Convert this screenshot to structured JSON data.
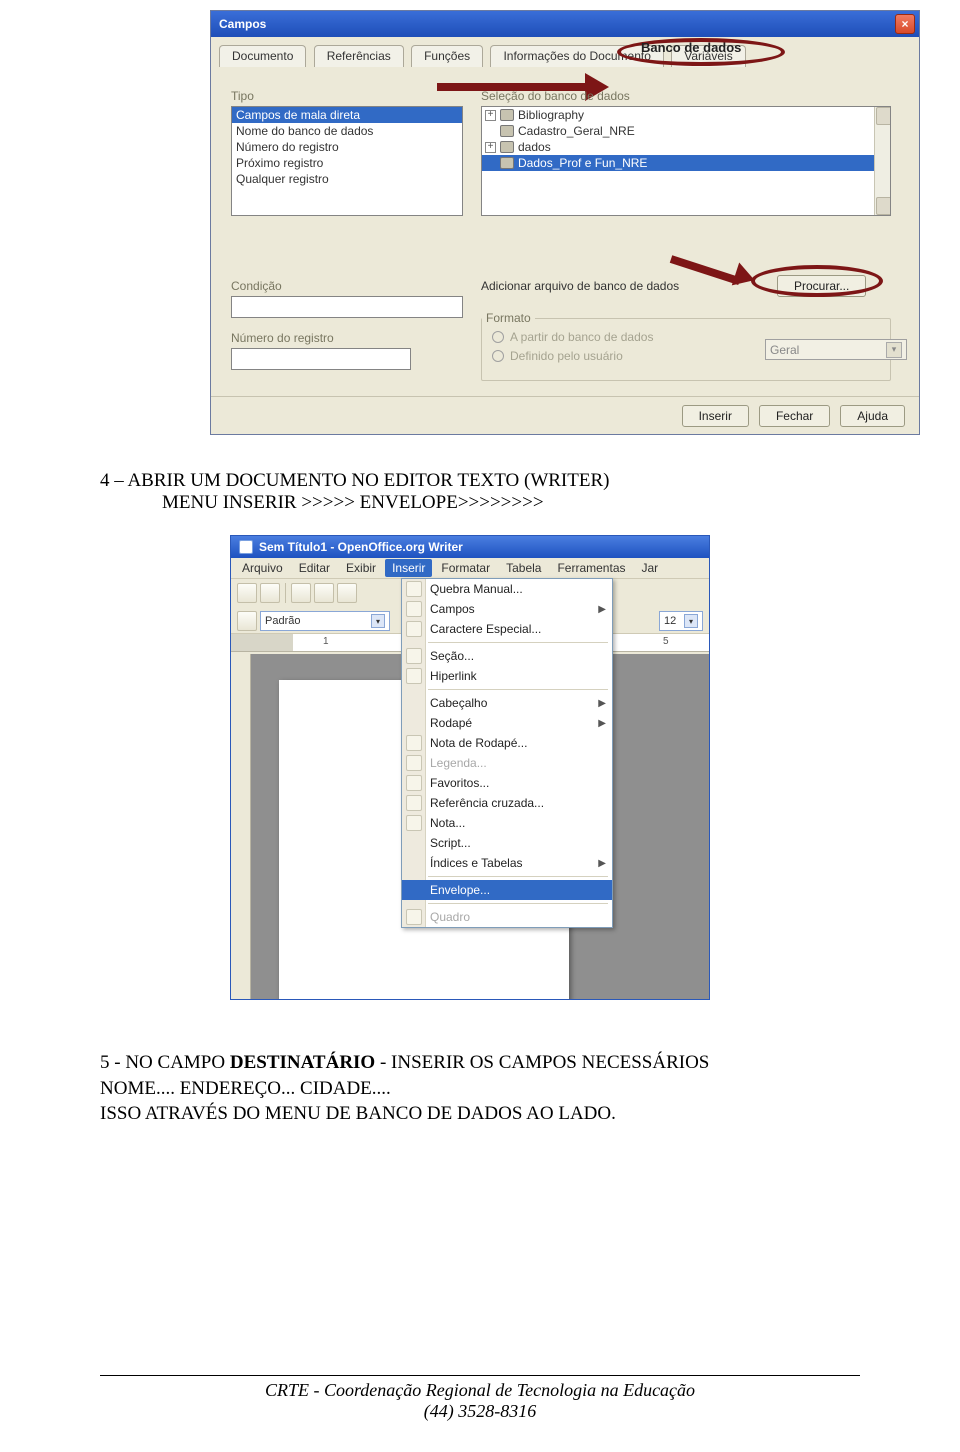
{
  "dialog1": {
    "title": "Campos",
    "close_glyph": "×",
    "tabs": [
      "Documento",
      "Referências",
      "Funções",
      "Informações do Documento",
      "Variáveis"
    ],
    "db_label": "Banco de dados",
    "type_label": "Tipo",
    "type_items": [
      "Campos de mala direta",
      "Nome do banco de dados",
      "Número do registro",
      "Próximo registro",
      "Qualquer registro"
    ],
    "sel_label": "Seleção do banco de dados",
    "sel_items": [
      "Bibliography",
      "Cadastro_Geral_NRE",
      "dados",
      "Dados_Prof e Fun_NRE"
    ],
    "cond_label": "Condição",
    "add_label": "Adicionar arquivo de banco de dados",
    "procurar_btn": "Procurar...",
    "reg_label": "Número do registro",
    "format_legend": "Formato",
    "radio1": "A partir do banco de dados",
    "radio2": "Definido pelo usuário",
    "format_select": "Geral",
    "btn_inserir": "Inserir",
    "btn_fechar": "Fechar",
    "btn_ajuda": "Ajuda"
  },
  "instr1": {
    "line1_a": "4 – ABRIR UM DOCUMENTO NO EDITOR TEXTO (WRITER)",
    "line2": "MENU INSERIR >>>>>     ENVELOPE>>>>>>>>"
  },
  "writer": {
    "title": "Sem Título1 - OpenOffice.org Writer",
    "menubar": [
      "Arquivo",
      "Editar",
      "Exibir",
      "Inserir",
      "Formatar",
      "Tabela",
      "Ferramentas",
      "Jar"
    ],
    "style_combo": "Padrão",
    "fontsize_combo": "12",
    "ruler_marks": [
      "1",
      "5"
    ],
    "menu_items": [
      {
        "label": "Quebra Manual...",
        "icon": true
      },
      {
        "label": "Campos",
        "icon": true,
        "sub": true
      },
      {
        "label": "Caractere Especial...",
        "icon": true
      },
      {
        "sep": true
      },
      {
        "label": "Seção...",
        "icon": true
      },
      {
        "label": "Hiperlink",
        "icon": true
      },
      {
        "sep": true
      },
      {
        "label": "Cabeçalho",
        "sub": true
      },
      {
        "label": "Rodapé",
        "sub": true
      },
      {
        "label": "Nota de Rodapé...",
        "icon": true
      },
      {
        "label": "Legenda...",
        "disabled": true,
        "icon": true
      },
      {
        "label": "Favoritos...",
        "icon": true
      },
      {
        "label": "Referência cruzada...",
        "icon": true
      },
      {
        "label": "Nota...",
        "icon": true
      },
      {
        "label": "Script...",
        "icon": false
      },
      {
        "label": "Índices e Tabelas",
        "sub": true
      },
      {
        "sep": true
      },
      {
        "label": "Envelope...",
        "sel": true
      },
      {
        "sep": true
      },
      {
        "label": "Quadro",
        "disabled": true,
        "icon": true
      }
    ]
  },
  "instr2": {
    "line1a": "5 - NO CAMPO ",
    "line1b": "DESTINATÁRIO",
    "line1c": " - INSERIR OS CAMPOS NECESSÁRIOS",
    "line2": "NOME.... ENDEREÇO... CIDADE....",
    "line3": "ISSO ATRAVÉS DO MENU DE BANCO DE DADOS AO LADO."
  },
  "footer": {
    "line1": "CRTE - Coordenação Regional de Tecnologia na Educação",
    "line2": "(44) 3528-8316"
  }
}
